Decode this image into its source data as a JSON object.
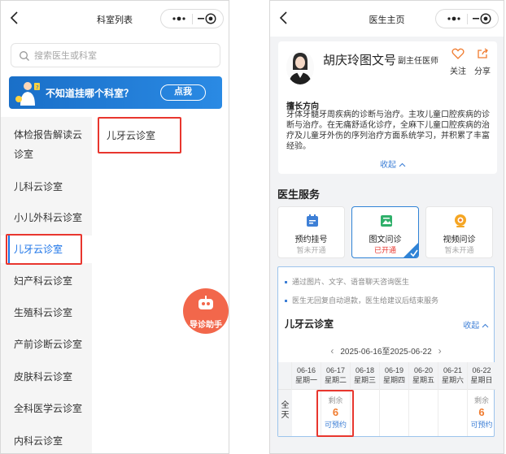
{
  "left_page": {
    "title": "科室列表",
    "search": {
      "placeholder": "搜索医生或科室"
    },
    "banner": {
      "text": "不知道挂哪个科室？",
      "button": "点我"
    },
    "departments": [
      {
        "label": "体检报告解读云诊室",
        "active": false
      },
      {
        "label": "儿科云诊室",
        "active": false
      },
      {
        "label": "小儿外科云诊室",
        "active": false
      },
      {
        "label": "儿牙云诊室",
        "active": true
      },
      {
        "label": "妇产科云诊室",
        "active": false
      },
      {
        "label": "生殖科云诊室",
        "active": false
      },
      {
        "label": "产前诊断云诊室",
        "active": false
      },
      {
        "label": "皮肤科云诊室",
        "active": false
      },
      {
        "label": "全科医学云诊室",
        "active": false
      },
      {
        "label": "内科云诊室",
        "active": false
      }
    ],
    "sub_department": "儿牙云诊室",
    "assistant_label": "导诊助手"
  },
  "right_page": {
    "title": "医生主页",
    "doctor": {
      "name": "胡庆玲图文号",
      "title": "副主任医师",
      "follow_label": "关注",
      "share_label": "分享",
      "specialty_heading": "擅长方向",
      "specialty_text": "牙体牙髓牙周疾病的诊断与治疗。主攻儿童口腔疾病的诊断与治疗。在无痛舒适化诊疗，全麻下儿童口腔疾病的治疗及儿童牙外伤的序列治疗方面系统学习，并积累了丰富经验。",
      "collapse_label": "收起"
    },
    "services_heading": "医生服务",
    "services": [
      {
        "name": "预约挂号",
        "status": "暂未开通",
        "active": false,
        "icon": "calendar-icon"
      },
      {
        "name": "图文问诊",
        "status": "已开通",
        "active": true,
        "icon": "chat-image-icon"
      },
      {
        "name": "视频问诊",
        "status": "暂未开通",
        "active": false,
        "icon": "video-icon"
      }
    ],
    "notes": [
      "通过图片、文字、语音聊天咨询医生",
      "医生无回复自动退款，医生给建议后结束服务"
    ],
    "department": "儿牙云诊室",
    "detail_collapse_label": "收起",
    "week_range": "2025-06-16至2025-06-22",
    "all_day_label": "全天",
    "schedule": [
      {
        "date": "06-16",
        "weekday": "星期一",
        "slot": null
      },
      {
        "date": "06-17",
        "weekday": "星期二",
        "slot": {
          "remain_label": "剩余",
          "count": "6",
          "action": "可预约"
        }
      },
      {
        "date": "06-18",
        "weekday": "星期三",
        "slot": null
      },
      {
        "date": "06-19",
        "weekday": "星期四",
        "slot": null
      },
      {
        "date": "06-20",
        "weekday": "星期五",
        "slot": null
      },
      {
        "date": "06-21",
        "weekday": "星期六",
        "slot": null
      },
      {
        "date": "06-22",
        "weekday": "星期日",
        "slot": {
          "remain_label": "剩余",
          "count": "6",
          "action": "可预约"
        }
      }
    ]
  },
  "colors": {
    "accent": "#1a73e8",
    "highlight": "#e8362e",
    "count": "#f07b2e",
    "banner": "#1a6fc8",
    "assistant": "#f2674b"
  }
}
